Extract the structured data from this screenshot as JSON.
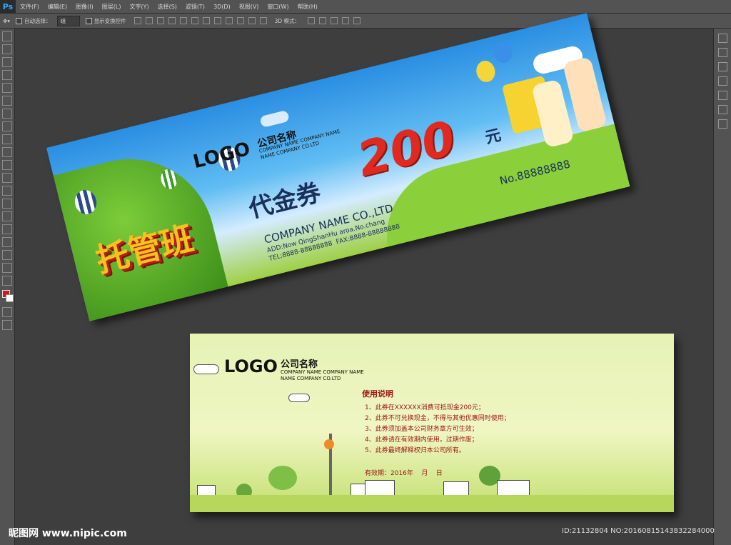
{
  "app": {
    "name": "Ps"
  },
  "menu": [
    "文件(F)",
    "编辑(E)",
    "图像(I)",
    "图层(L)",
    "文字(Y)",
    "选择(S)",
    "滤镜(T)",
    "3D(D)",
    "视图(V)",
    "窗口(W)",
    "帮助(H)"
  ],
  "options": {
    "auto_select_label": "自动选择：",
    "auto_select_value": "组",
    "show_transform_label": "显示变换控件",
    "mode_3d_label": "3D 模式："
  },
  "front": {
    "logo": "LOGO",
    "company_cn": "公司名称",
    "company_en_1": "COMPANY NAME COMPANY NAME",
    "company_en_2": "NAME COMPANY CO.LTD",
    "big_title": "托管班",
    "voucher_label": "代金券",
    "amount": "200",
    "currency": "元",
    "serial": "No.88888888",
    "company_full": "COMPANY NAME CO.,LTD",
    "addr": "ADD:Now QingShanHu aroa.No.chang",
    "tel_fax": "TEL:8888-88888888  FAX:8888-88888888"
  },
  "back": {
    "logo": "LOGO",
    "company_cn": "公司名称",
    "company_en_1": "COMPANY NAME COMPANY NAME",
    "company_en_2": "NAME COMPANY CO.LTD",
    "usage_title": "使用说明",
    "rules": [
      "1、此券在XXXXXX消费可抵现金200元；",
      "2、此券不可兑换现金，不得与其他优惠同时使用；",
      "3、此券须加盖本公司财务章方可生效；",
      "4、此券请在有效期内使用，过期作废；",
      "5、此券最终解释权归本公司所有。"
    ],
    "validity": "有效期：2016年    月    日"
  },
  "footer": {
    "watermark": "昵图网 www.nipic.com",
    "id": "ID:21132804 NO:20160815143832284000"
  },
  "colors": {
    "ps_bg": "#3c3c3c",
    "panel": "#535353",
    "amount_red": "#e02a20",
    "title_yellow": "#f6c21b",
    "title_red": "#d6221b"
  }
}
